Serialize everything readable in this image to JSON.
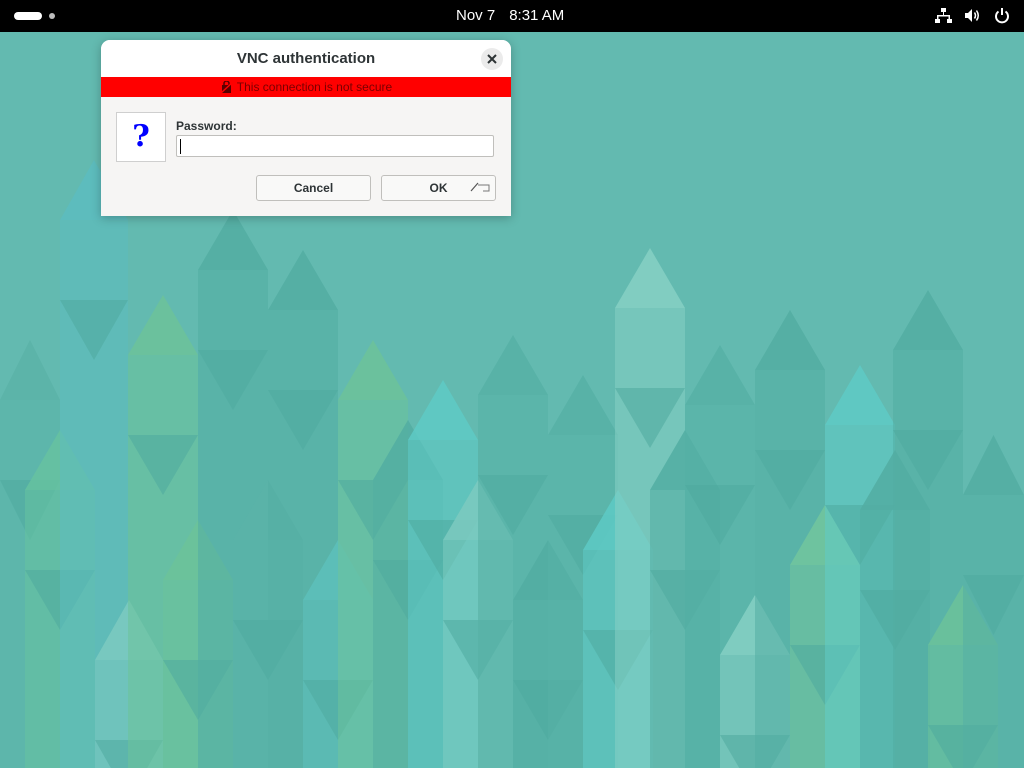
{
  "topbar": {
    "date": "Nov 7",
    "time": "8:31 AM",
    "icons": [
      "network-icon",
      "volume-icon",
      "power-icon"
    ]
  },
  "dialog": {
    "title": "VNC authentication",
    "warning": "This connection is not secure",
    "password_label": "Password:",
    "password_value": "",
    "question_glyph": "?",
    "cancel_label": "Cancel",
    "ok_label": "OK"
  },
  "colors": {
    "desktop": "#63bab0",
    "warning_banner": "#ff0000",
    "question_glyph": "#0000ff"
  }
}
